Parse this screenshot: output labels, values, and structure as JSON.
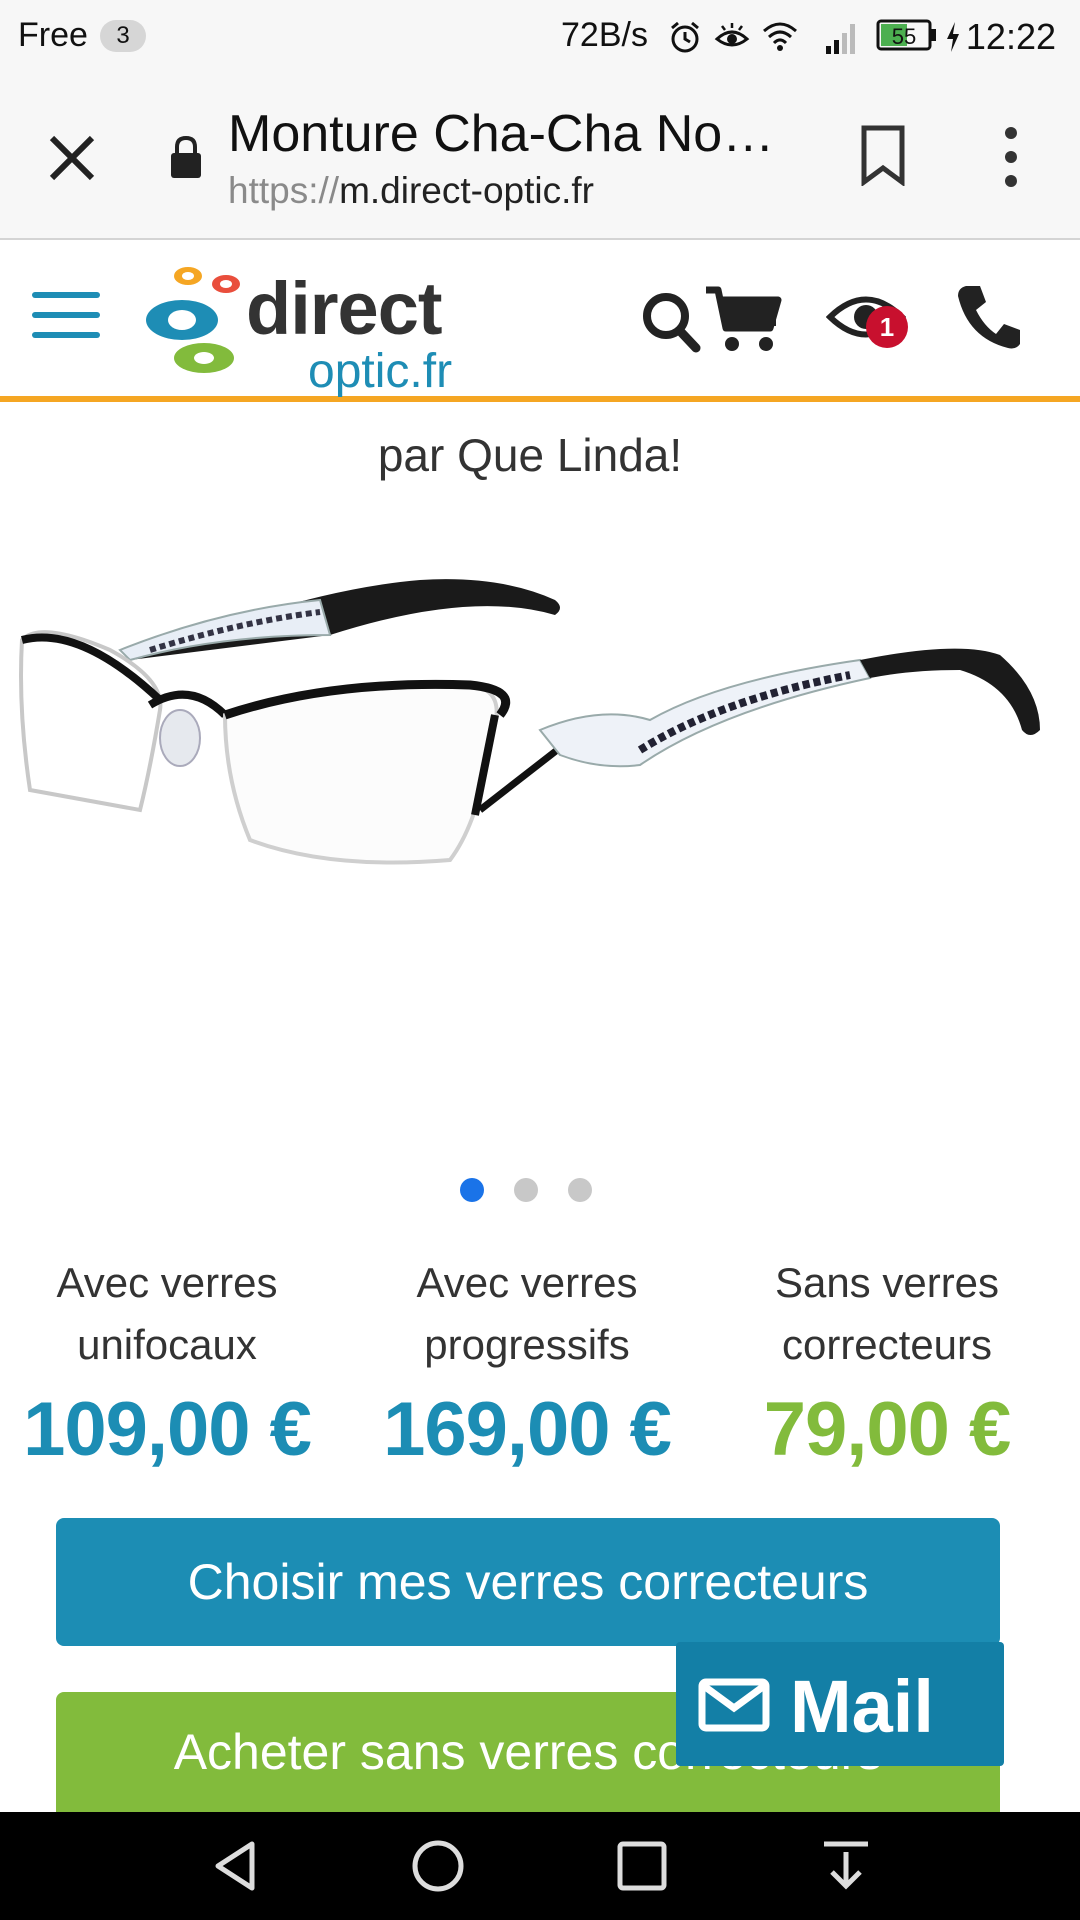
{
  "status_bar": {
    "carrier": "Free",
    "sim_badge": "3",
    "network_speed": "72B/s",
    "battery": "55",
    "time": "12:22",
    "icons": [
      "alarm-icon",
      "eye-comfort-icon",
      "wifi-icon",
      "signal-icon",
      "battery-icon",
      "charging-icon"
    ]
  },
  "browser": {
    "page_title": "Monture Cha-Cha No…",
    "url_scheme": "https://",
    "url_host": "m.direct-optic.fr",
    "icons": [
      "close-icon",
      "lock-icon",
      "bookmark-icon",
      "overflow-menu-icon"
    ]
  },
  "site_header": {
    "logo_direct": "direct",
    "logo_optic": "optic.fr",
    "eye_badge_count": "1",
    "icons": [
      "hamburger-menu-icon",
      "search-icon",
      "cart-icon",
      "eye-icon",
      "phone-icon"
    ],
    "accent_color": "#f5a623",
    "brand_color": "#1e8db5"
  },
  "product": {
    "brand_line": "par Que Linda!",
    "image": "eyeglasses-photo",
    "carousel": {
      "count": 3,
      "active": 1
    }
  },
  "prices": [
    {
      "label_line1": "Avec verres",
      "label_line2": "unifocaux",
      "value": "109,00 €",
      "color": "#1c8db4"
    },
    {
      "label_line1": "Avec verres",
      "label_line2": "progressifs",
      "value": "169,00 €",
      "color": "#1c8db4"
    },
    {
      "label_line1": "Sans verres",
      "label_line2": "correcteurs",
      "value": "79,00 €",
      "color": "#82bb3c"
    }
  ],
  "actions": {
    "primary_label": "Choisir mes verres correcteurs",
    "secondary_label": "Acheter sans verres correcteurs",
    "mail_label": "Mail"
  },
  "nav_bar": {
    "icons": [
      "back-icon",
      "home-icon",
      "recents-icon",
      "notification-pull-icon"
    ]
  }
}
